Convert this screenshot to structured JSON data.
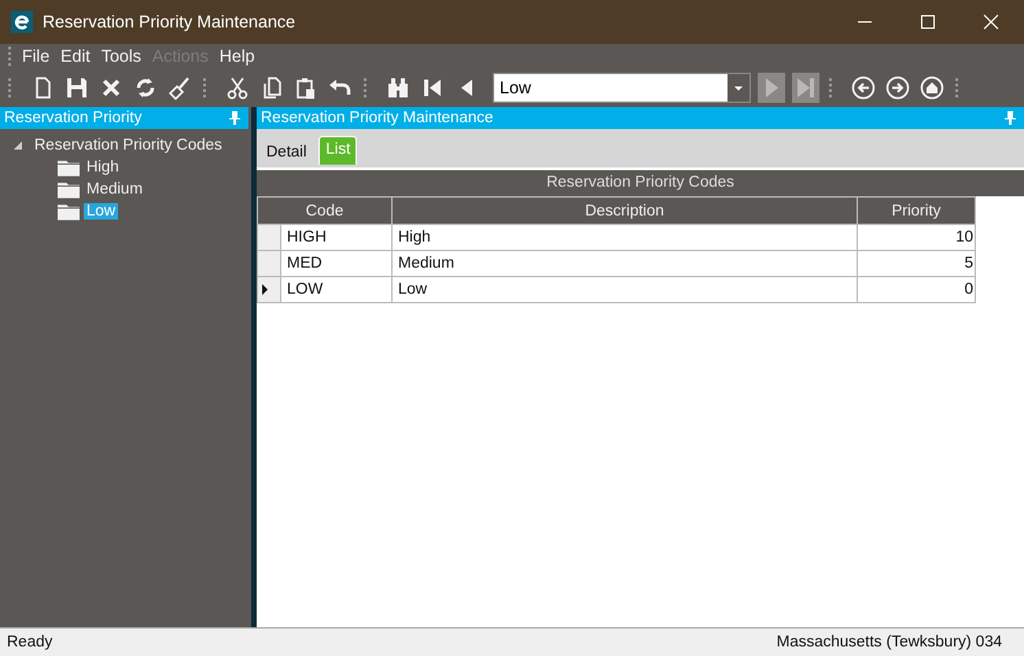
{
  "window": {
    "title": "Reservation Priority Maintenance"
  },
  "menu": [
    {
      "label": "File",
      "disabled": false
    },
    {
      "label": "Edit",
      "disabled": false
    },
    {
      "label": "Tools",
      "disabled": false
    },
    {
      "label": "Actions",
      "disabled": true
    },
    {
      "label": "Help",
      "disabled": false
    }
  ],
  "toolbar": {
    "record_selector": {
      "value": "Low"
    },
    "next_disabled": true,
    "last_disabled": true
  },
  "sidebar": {
    "title": "Reservation Priority",
    "tree": [
      {
        "label": "Reservation Priority Codes",
        "expanded": true,
        "selected": false,
        "children": [
          {
            "label": "High",
            "selected": false
          },
          {
            "label": "Medium",
            "selected": false
          },
          {
            "label": "Low",
            "selected": true
          }
        ]
      }
    ]
  },
  "main": {
    "panel_title": "Reservation Priority Maintenance",
    "tabs": [
      {
        "label": "Detail",
        "selected": false
      },
      {
        "label": "List",
        "selected": true
      }
    ],
    "table": {
      "caption": "Reservation Priority Codes",
      "columns": [
        "Code",
        "Description",
        "Priority"
      ],
      "rows": [
        {
          "cells": [
            "HIGH",
            "High",
            "10"
          ],
          "selected": false
        },
        {
          "cells": [
            "MED",
            "Medium",
            "5"
          ],
          "selected": false
        },
        {
          "cells": [
            "LOW",
            "Low",
            "0"
          ],
          "selected": true
        }
      ]
    }
  },
  "status_bar": {
    "left": "Ready",
    "right": "Massachusetts (Tewksbury) 034"
  }
}
